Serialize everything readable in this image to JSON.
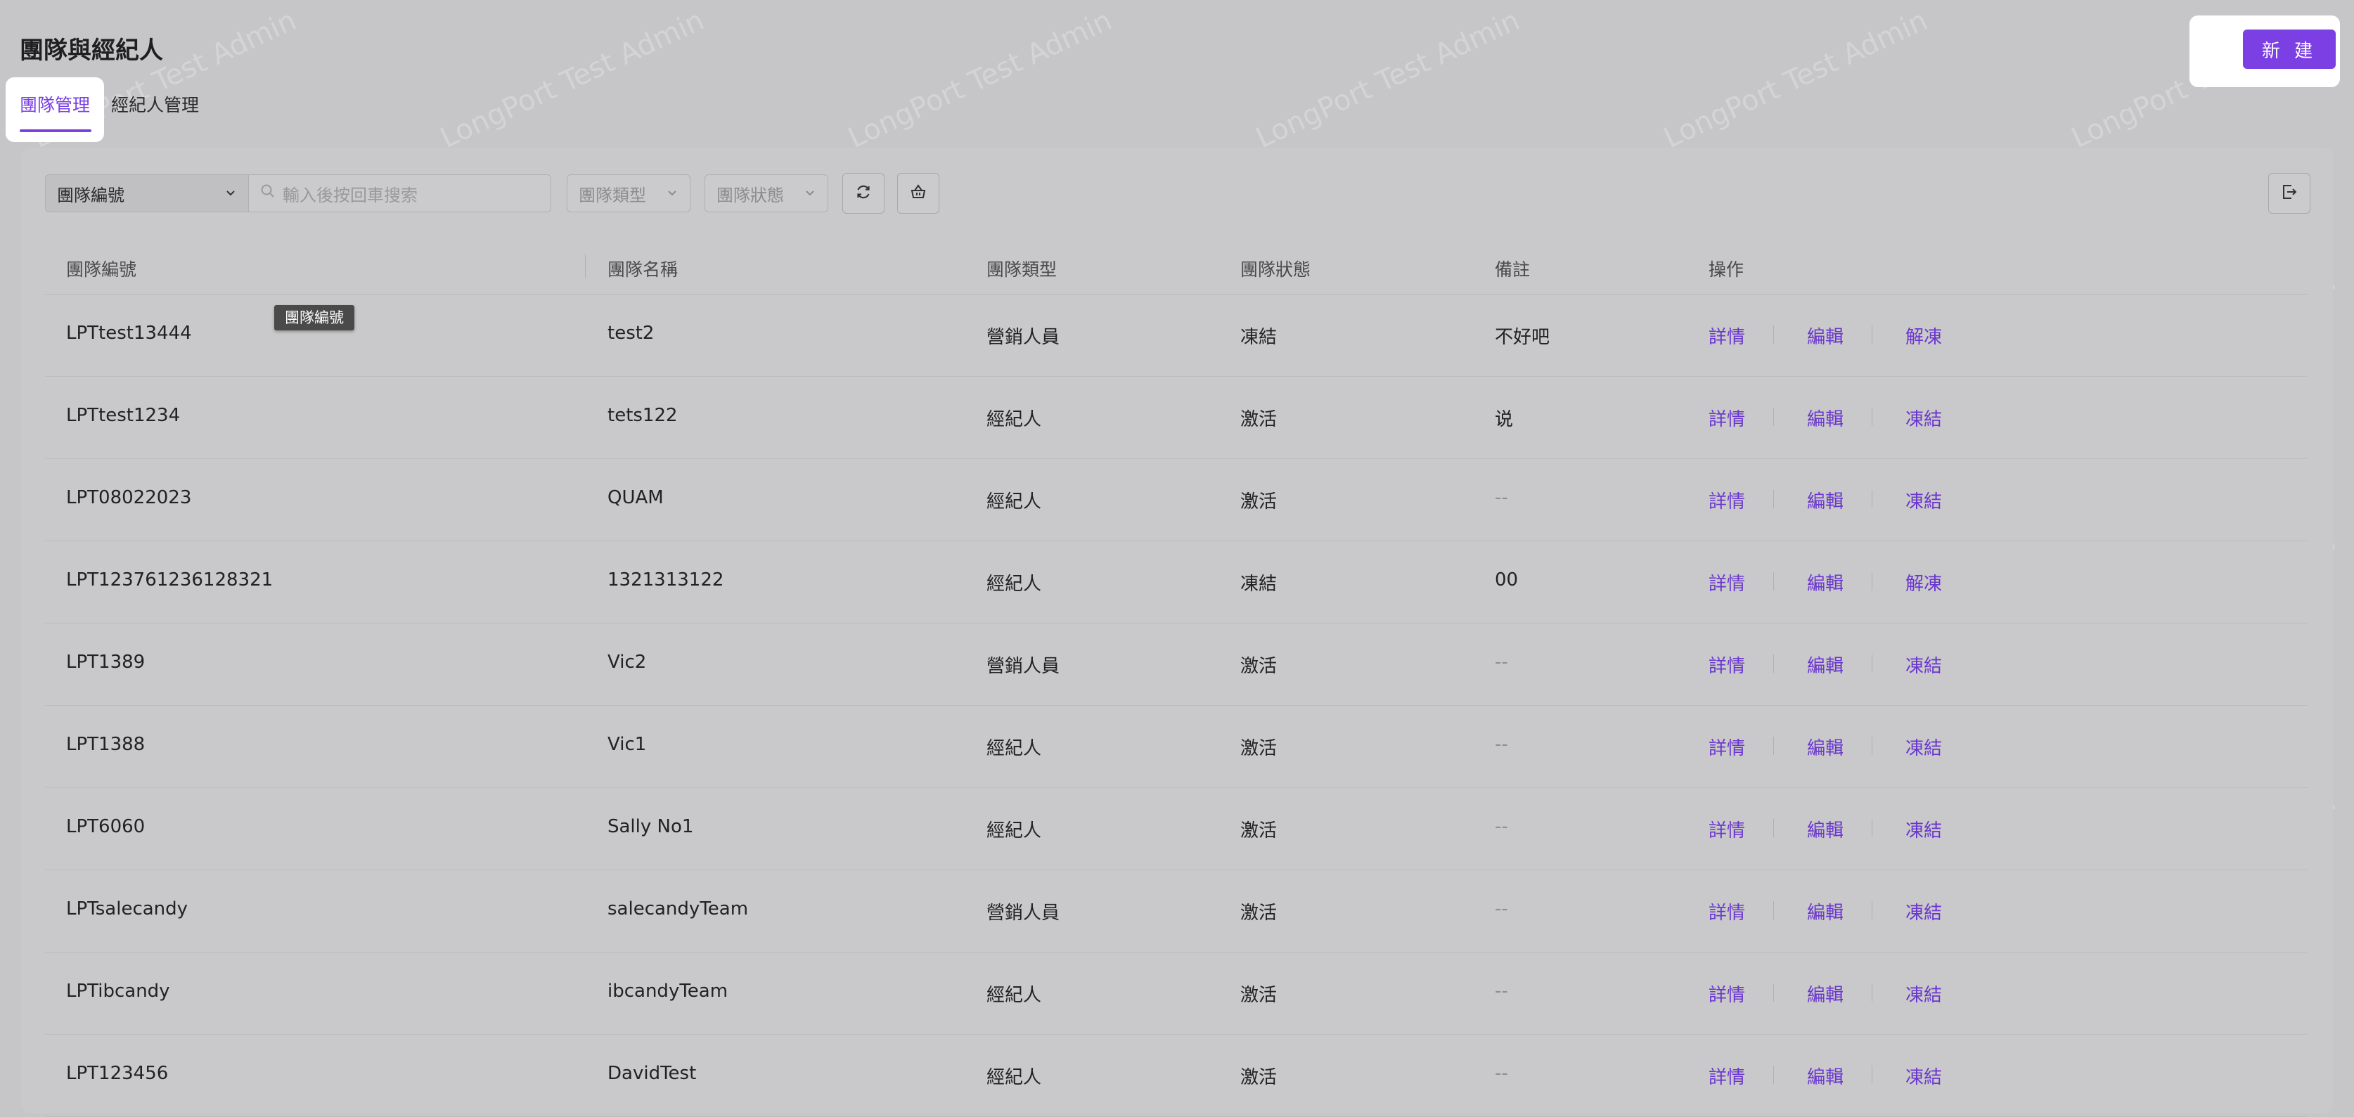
{
  "header": {
    "title": "團隊與經紀人",
    "new_label": "新 建"
  },
  "tabs": [
    {
      "label": "團隊管理",
      "active": true
    },
    {
      "label": "經紀人管理",
      "active": false
    }
  ],
  "toolbar": {
    "field_select": "團隊編號",
    "search_placeholder": "輸入後按回車搜索",
    "type_select": "團隊類型",
    "status_select": "團隊狀態"
  },
  "tooltip": "團隊編號",
  "watermark": "LongPort Test Admin",
  "columns": [
    "團隊編號",
    "團隊名稱",
    "團隊類型",
    "團隊狀態",
    "備註",
    "操作"
  ],
  "rows": [
    {
      "id": "LPTtest13444",
      "name": "test2",
      "type": "營銷人員",
      "status": "凍結",
      "note": "不好吧",
      "a1": "詳情",
      "a2": "編輯",
      "a3": "解凍"
    },
    {
      "id": "LPTtest1234",
      "name": "tets122",
      "type": "經紀人",
      "status": "激活",
      "note": "说",
      "a1": "詳情",
      "a2": "編輯",
      "a3": "凍結"
    },
    {
      "id": "LPT08022023",
      "name": "QUAM",
      "type": "經紀人",
      "status": "激活",
      "note": "--",
      "a1": "詳情",
      "a2": "編輯",
      "a3": "凍結"
    },
    {
      "id": "LPT123761236128321",
      "name": "1321313122",
      "type": "經紀人",
      "status": "凍結",
      "note": "00",
      "a1": "詳情",
      "a2": "編輯",
      "a3": "解凍"
    },
    {
      "id": "LPT1389",
      "name": "Vic2",
      "type": "營銷人員",
      "status": "激活",
      "note": "--",
      "a1": "詳情",
      "a2": "編輯",
      "a3": "凍結"
    },
    {
      "id": "LPT1388",
      "name": "Vic1",
      "type": "經紀人",
      "status": "激活",
      "note": "--",
      "a1": "詳情",
      "a2": "編輯",
      "a3": "凍結"
    },
    {
      "id": "LPT6060",
      "name": "Sally No1",
      "type": "經紀人",
      "status": "激活",
      "note": "--",
      "a1": "詳情",
      "a2": "編輯",
      "a3": "凍結"
    },
    {
      "id": "LPTsalecandy",
      "name": "salecandyTeam",
      "type": "營銷人員",
      "status": "激活",
      "note": "--",
      "a1": "詳情",
      "a2": "編輯",
      "a3": "凍結"
    },
    {
      "id": "LPTibcandy",
      "name": "ibcandyTeam",
      "type": "經紀人",
      "status": "激活",
      "note": "--",
      "a1": "詳情",
      "a2": "編輯",
      "a3": "凍結"
    },
    {
      "id": "LPT123456",
      "name": "DavidTest",
      "type": "經紀人",
      "status": "激活",
      "note": "--",
      "a1": "詳情",
      "a2": "編輯",
      "a3": "凍結"
    }
  ],
  "colors": {
    "accent": "#7b3fe4",
    "link": "#6a36cf"
  }
}
